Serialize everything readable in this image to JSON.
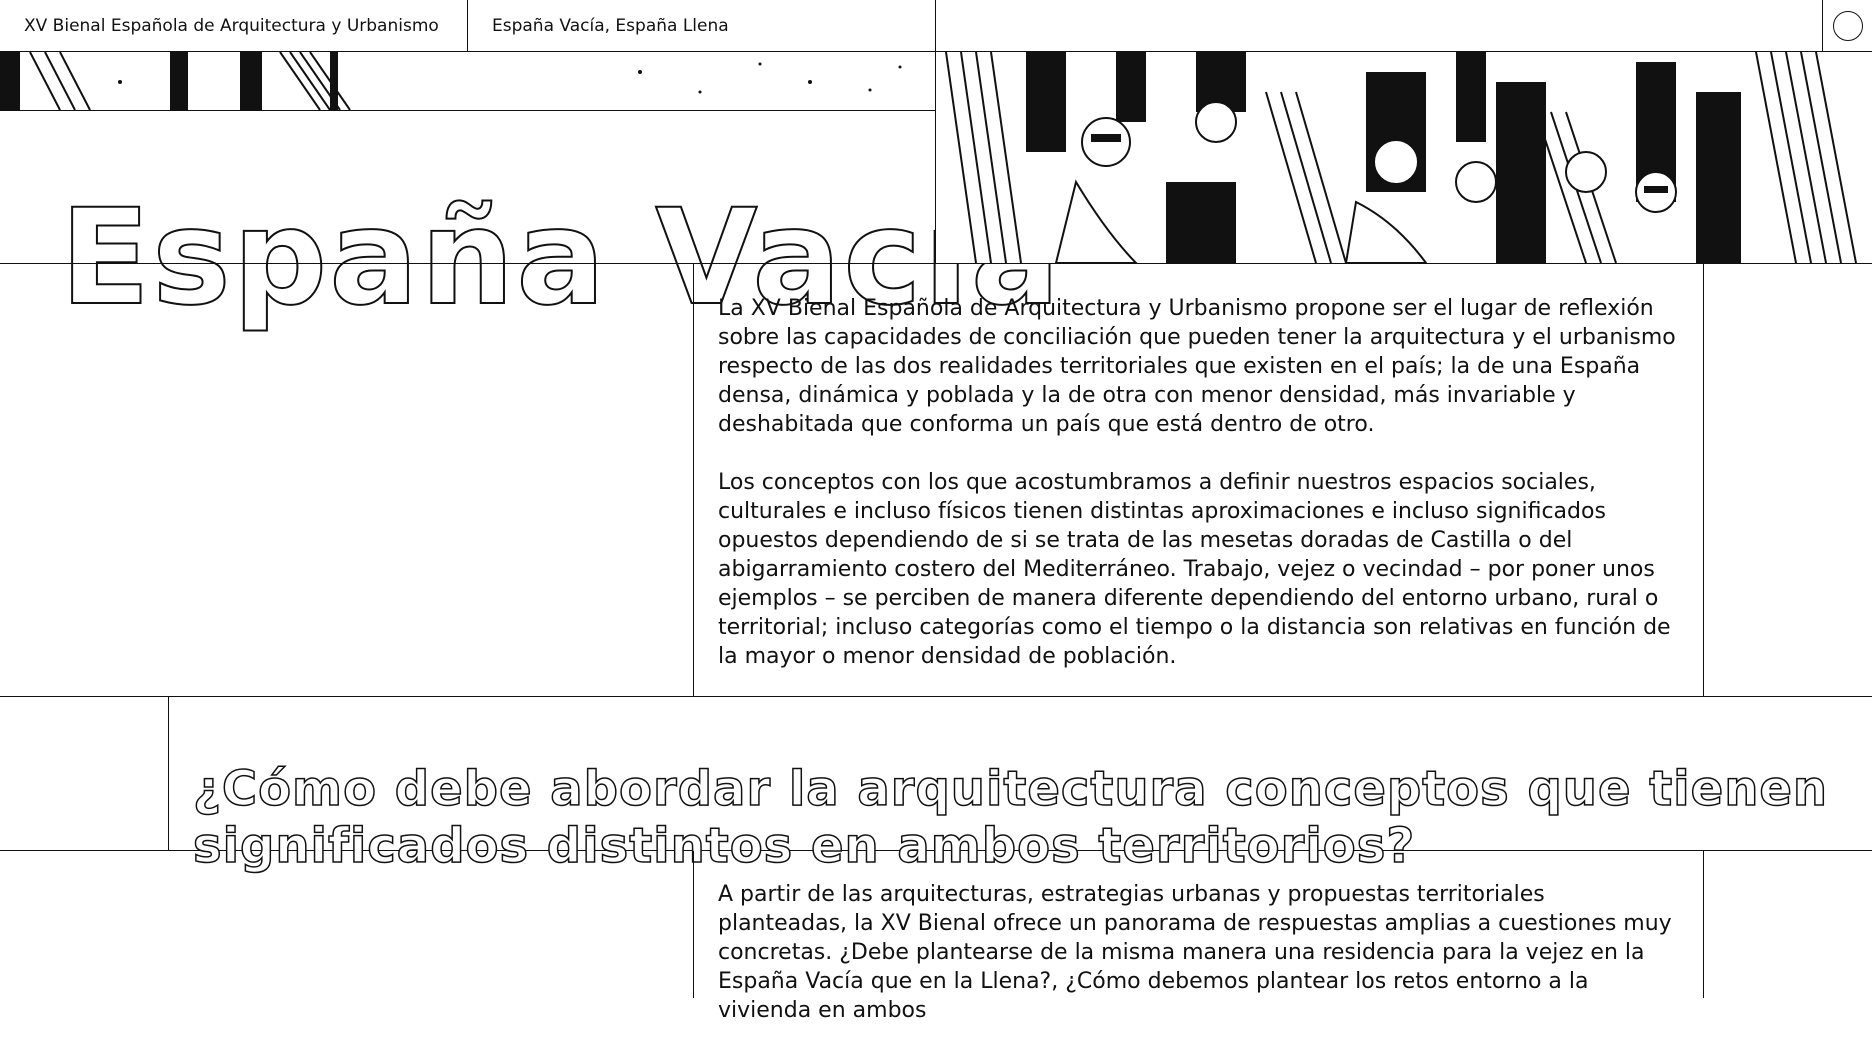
{
  "header": {
    "site_title": "XV Bienal Española de Arquitectura y Urbanismo",
    "section_title": "España Vacía, España Llena",
    "menu_icon": "circle-menu-icon"
  },
  "hero": {
    "title": "España Vacía",
    "image": "crowd-illustration"
  },
  "intro": {
    "paragraph1": "La XV Bienal Española de Arquitectura y Urbanismo propone ser el lugar de reflexión sobre las capacidades de conciliación que pueden tener la arquitectura y el urbanismo respecto de las dos realidades territoriales que existen en el país; la de una España densa, dinámica y poblada y la de otra con menor densidad, más invariable y deshabitada que conforma un país que está dentro de otro.",
    "paragraph2": "Los conceptos con los que acostumbramos a definir nuestros espacios sociales, culturales e incluso físicos tienen distintas aproximaciones e incluso significados opuestos dependiendo de si se trata de las mesetas doradas de Castilla o del abigarramiento costero del Mediterráneo. Trabajo, vejez o vecindad – por poner unos ejemplos – se perciben de manera diferente dependiendo del entorno urbano, rural o territorial; incluso categorías como el tiempo o la distancia son relativas en función de la mayor o menor densidad de población."
  },
  "question": {
    "text": "¿Cómo debe abordar la arquitectura conceptos que tienen significados distintos en ambos territorios?"
  },
  "followup": {
    "paragraph1": "A partir de las arquitecturas, estrategias urbanas y propuestas territoriales planteadas, la XV Bienal ofrece un panorama de respuestas amplias a cuestiones muy concretas. ¿Debe plantearse de la misma manera una residencia para la vejez en la España Vacía que en la Llena?, ¿Cómo debemos plantear los retos entorno a la vivienda en ambos"
  }
}
